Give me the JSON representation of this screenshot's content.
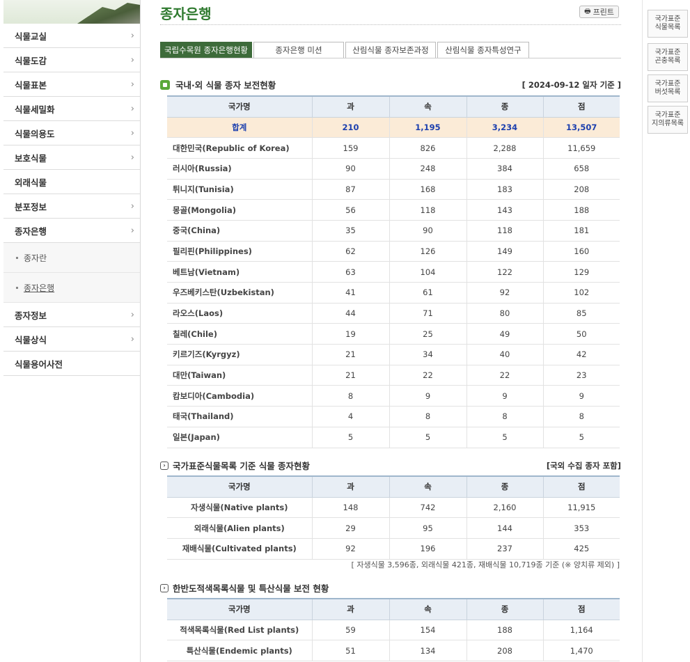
{
  "sidebar": {
    "items": [
      {
        "label": "식물교실",
        "chevron": true
      },
      {
        "label": "식물도감",
        "chevron": true
      },
      {
        "label": "식물표본",
        "chevron": true
      },
      {
        "label": "식물세밀화",
        "chevron": true
      },
      {
        "label": "식물의용도",
        "chevron": true
      },
      {
        "label": "보호식물",
        "chevron": true
      },
      {
        "label": "외래식물",
        "chevron": false
      },
      {
        "label": "분포정보",
        "chevron": true
      },
      {
        "label": "종자은행",
        "chevron": true
      }
    ],
    "subitems": [
      {
        "label": "종자란",
        "active": false
      },
      {
        "label": "종자은행",
        "active": true
      }
    ],
    "items_after": [
      {
        "label": "종자정보",
        "chevron": true
      },
      {
        "label": "식물상식",
        "chevron": true
      },
      {
        "label": "식물용어사전",
        "chevron": false
      }
    ],
    "chevron_glyph": "›"
  },
  "header": {
    "title": "종자은행",
    "print_label": "프린트"
  },
  "tabs": [
    {
      "label": "국립수목원 종자은행현황",
      "active": true
    },
    {
      "label": "종자은행 미션",
      "active": false
    },
    {
      "label": "산림식물 종자보존과정",
      "active": false
    },
    {
      "label": "산림식물 종자특성연구",
      "active": false
    }
  ],
  "section1": {
    "title": "국내·외 식물 종자 보전현황",
    "date_note": "[ 2024-09-12 일자 기준 ]",
    "columns": [
      "국가명",
      "과",
      "속",
      "종",
      "점"
    ],
    "total": [
      "합계",
      "210",
      "1,195",
      "3,234",
      "13,507"
    ],
    "rows": [
      [
        "대한민국(Republic of Korea)",
        "159",
        "826",
        "2,288",
        "11,659"
      ],
      [
        "러시아(Russia)",
        "90",
        "248",
        "384",
        "658"
      ],
      [
        "튀니지(Tunisia)",
        "87",
        "168",
        "183",
        "208"
      ],
      [
        "몽골(Mongolia)",
        "56",
        "118",
        "143",
        "188"
      ],
      [
        "중국(China)",
        "35",
        "90",
        "118",
        "181"
      ],
      [
        "필리핀(Philippines)",
        "62",
        "126",
        "149",
        "160"
      ],
      [
        "베트남(Vietnam)",
        "63",
        "104",
        "122",
        "129"
      ],
      [
        "우즈베키스탄(Uzbekistan)",
        "41",
        "61",
        "92",
        "102"
      ],
      [
        "라오스(Laos)",
        "44",
        "71",
        "80",
        "85"
      ],
      [
        "칠레(Chile)",
        "19",
        "25",
        "49",
        "50"
      ],
      [
        "키르기즈(Kyrgyz)",
        "21",
        "34",
        "40",
        "42"
      ],
      [
        "대만(Taiwan)",
        "21",
        "22",
        "22",
        "23"
      ],
      [
        "캄보디아(Cambodia)",
        "8",
        "9",
        "9",
        "9"
      ],
      [
        "태국(Thailand)",
        "4",
        "8",
        "8",
        "8"
      ],
      [
        "일본(Japan)",
        "5",
        "5",
        "5",
        "5"
      ]
    ]
  },
  "section2": {
    "title": "국가표준식물목록 기준 식물 종자현황",
    "note_right": "[국외 수집 종자 포함]",
    "columns": [
      "국가명",
      "과",
      "속",
      "종",
      "점"
    ],
    "rows": [
      [
        "자생식물(Native plants)",
        "148",
        "742",
        "2,160",
        "11,915"
      ],
      [
        "외래식물(Alien plants)",
        "29",
        "95",
        "144",
        "353"
      ],
      [
        "재배식물(Cultivated plants)",
        "92",
        "196",
        "237",
        "425"
      ]
    ],
    "footnote": "[ 자생식물 3,596종,  외래식물 421종,  재배식물 10,719종 기준 (※ 양치류 제외) ]"
  },
  "section3": {
    "title": "한반도적색목록식물 및 특산식물 보전 현황",
    "columns": [
      "국가명",
      "과",
      "속",
      "종",
      "점"
    ],
    "rows": [
      [
        "적색목록식물(Red List plants)",
        "59",
        "154",
        "188",
        "1,164"
      ],
      [
        "특산식물(Endemic plants)",
        "51",
        "134",
        "208",
        "1,470"
      ]
    ]
  },
  "quick_links": [
    {
      "line1": "국가표준",
      "line2": "식물목록"
    },
    {
      "line1": "국가표준",
      "line2": "곤충목록"
    },
    {
      "line1": "국가표준",
      "line2": "버섯목록"
    },
    {
      "line1": "국가표준",
      "line2": "지의류목록"
    }
  ]
}
